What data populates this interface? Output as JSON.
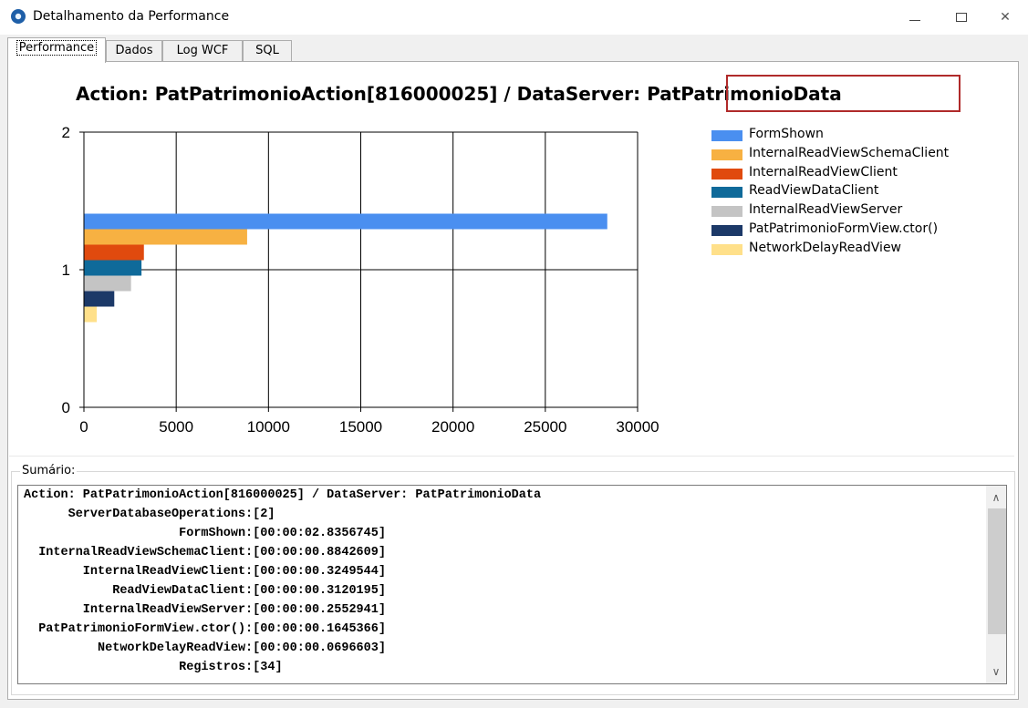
{
  "window": {
    "title": "Detalhamento da Performance",
    "controls": {
      "minimize": "minimize-icon",
      "maximize": "maximize-icon",
      "close": "close-icon"
    }
  },
  "tabs": [
    {
      "label": "Performance",
      "active": true
    },
    {
      "label": "Dados",
      "active": false
    },
    {
      "label": "Log WCF",
      "active": false
    },
    {
      "label": "SQL",
      "active": false
    }
  ],
  "chart_data": {
    "type": "bar",
    "orientation": "horizontal",
    "title_prefix": "Action: PatPatrimonioAction[816000025] / DataServer: ",
    "title_highlight": "PatPatrimonioData",
    "xlim": [
      0,
      30000
    ],
    "ylim": [
      0,
      2
    ],
    "xticks": [
      0,
      5000,
      10000,
      15000,
      20000,
      25000,
      30000
    ],
    "yticks": [
      0,
      1,
      2
    ],
    "grid": true,
    "legend_position": "right",
    "series": [
      {
        "name": "FormShown",
        "value": 28357,
        "color": "#4a8ff0"
      },
      {
        "name": "InternalReadViewSchemaClient",
        "value": 8843,
        "color": "#f7b142"
      },
      {
        "name": "InternalReadViewClient",
        "value": 3250,
        "color": "#e04a0e"
      },
      {
        "name": "ReadViewDataClient",
        "value": 3120,
        "color": "#0f6a9a"
      },
      {
        "name": "InternalReadViewServer",
        "value": 2553,
        "color": "#c4c4c4"
      },
      {
        "name": "PatPatrimonioFormView.ctor()",
        "value": 1645,
        "color": "#1c3968"
      },
      {
        "name": "NetworkDelayReadView",
        "value": 697,
        "color": "#ffe08a"
      }
    ]
  },
  "summary": {
    "label": "Sumário:",
    "lines": [
      "Action: PatPatrimonioAction[816000025] / DataServer: PatPatrimonioData",
      "      ServerDatabaseOperations:[2]",
      "                     FormShown:[00:00:02.8356745]",
      "  InternalReadViewSchemaClient:[00:00:00.8842609]",
      "        InternalReadViewClient:[00:00:00.3249544]",
      "            ReadViewDataClient:[00:00:00.3120195]",
      "        InternalReadViewServer:[00:00:00.2552941]",
      "  PatPatrimonioFormView.ctor():[00:00:00.1645366]",
      "          NetworkDelayReadView:[00:00:00.0696603]",
      "                     Registros:[34]"
    ],
    "scroll_up": "chevron-up-icon",
    "scroll_down": "chevron-down-icon"
  }
}
